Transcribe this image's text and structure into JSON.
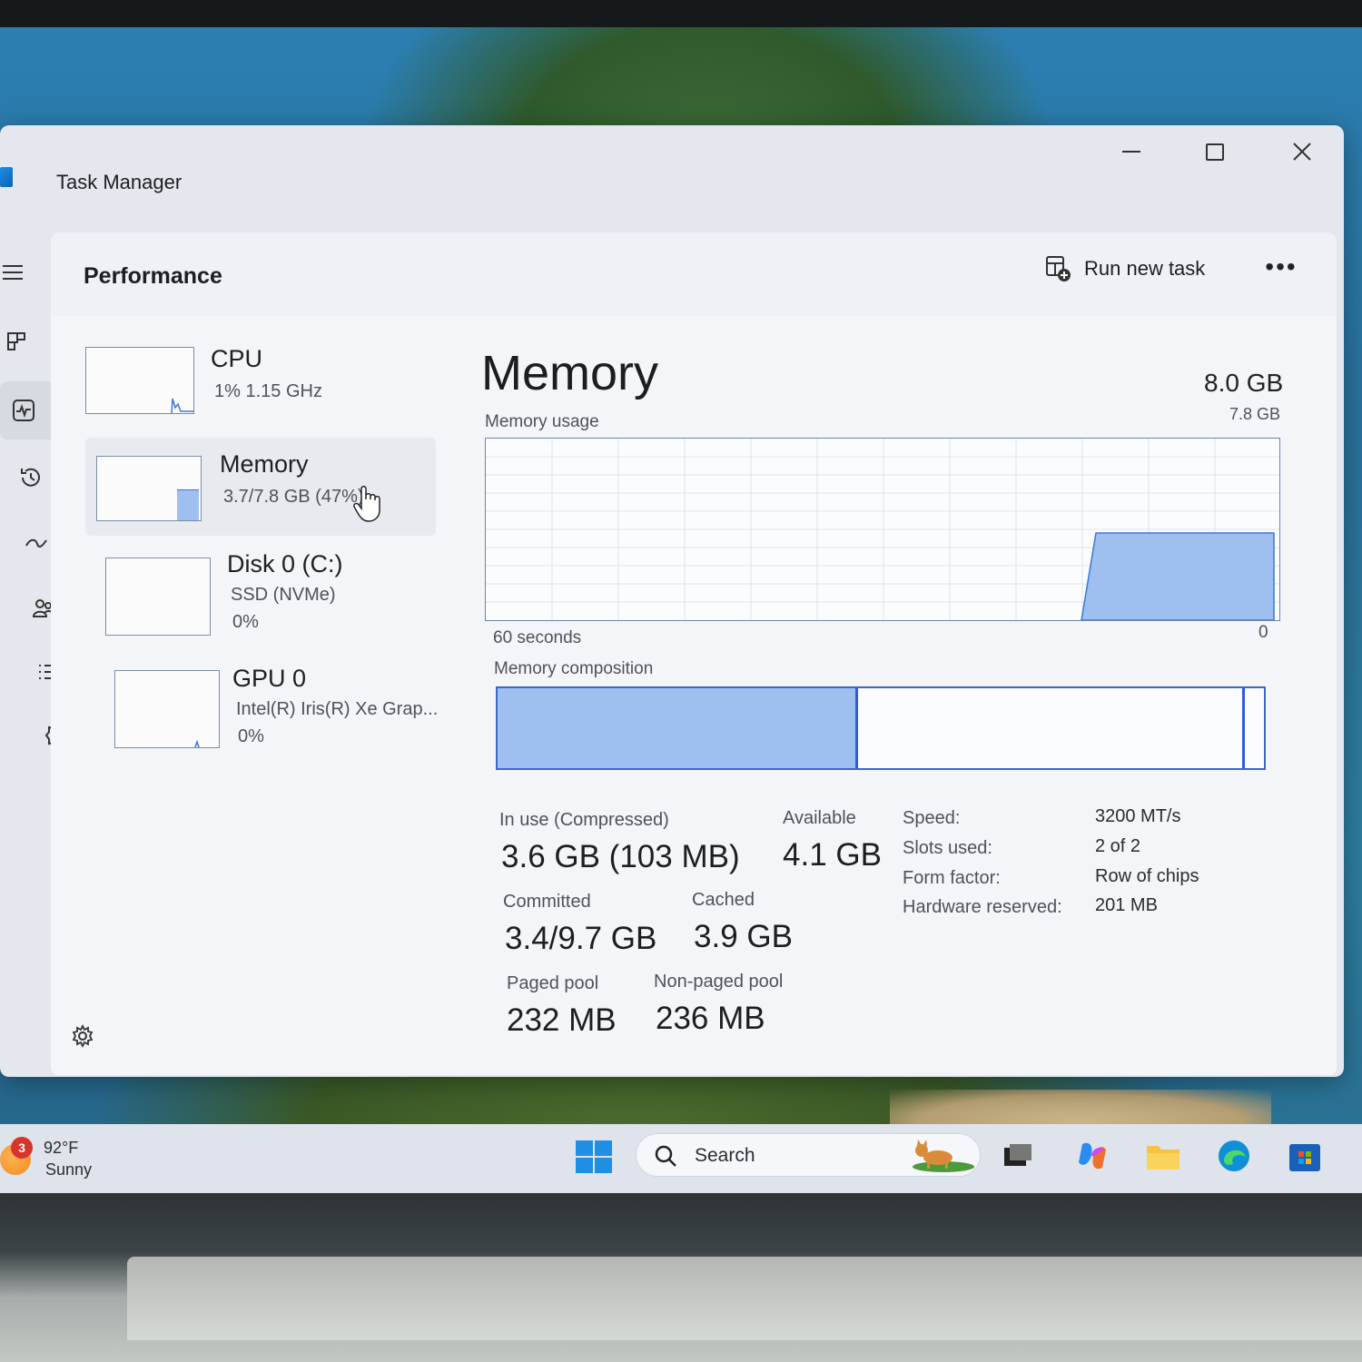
{
  "window": {
    "title": "Task Manager",
    "controls": [
      "minimize",
      "maximize",
      "close"
    ]
  },
  "nav": {
    "icons": [
      "menu-icon",
      "processes-icon",
      "performance-icon",
      "app-history-icon",
      "startup-apps-icon",
      "users-icon",
      "details-icon",
      "services-icon",
      "settings-icon"
    ],
    "active": "performance-icon"
  },
  "header": {
    "title": "Performance",
    "run_new_task": "Run new task",
    "more": "•••"
  },
  "devices": [
    {
      "name": "CPU",
      "line1": "1%  1.15 GHz",
      "line2": ""
    },
    {
      "name": "Memory",
      "line1": "3.7/7.8 GB (47%)",
      "line2": "",
      "selected": true
    },
    {
      "name": "Disk 0 (C:)",
      "line1": "SSD (NVMe)",
      "line2": "0%"
    },
    {
      "name": "GPU 0",
      "line1": "Intel(R) Iris(R) Xe Grap...",
      "line2": "0%"
    }
  ],
  "memory": {
    "title": "Memory",
    "total": "8.0 GB",
    "usage_label": "Memory usage",
    "usage_max": "7.8 GB",
    "time_span": "60 seconds",
    "axis_zero": "0",
    "composition_label": "Memory composition",
    "in_use_fraction": 0.47,
    "stats": {
      "in_use_label": "In use (Compressed)",
      "in_use_value": "3.6 GB (103 MB)",
      "available_label": "Available",
      "available_value": "4.1 GB",
      "committed_label": "Committed",
      "committed_value": "3.4/9.7 GB",
      "cached_label": "Cached",
      "cached_value": "3.9 GB",
      "paged_label": "Paged pool",
      "paged_value": "232 MB",
      "nonpaged_label": "Non-paged pool",
      "nonpaged_value": "236 MB"
    },
    "details": [
      {
        "k": "Speed:",
        "v": "3200 MT/s"
      },
      {
        "k": "Slots used:",
        "v": "2 of 2"
      },
      {
        "k": "Form factor:",
        "v": "Row of chips"
      },
      {
        "k": "Hardware reserved:",
        "v": "201 MB"
      }
    ]
  },
  "taskbar": {
    "weather_badge": "3",
    "temperature": "92°F",
    "condition": "Sunny",
    "search_placeholder": "Search",
    "apps": [
      "start-icon",
      "task-view-icon",
      "copilot-icon",
      "file-explorer-icon",
      "edge-icon",
      "store-icon"
    ]
  },
  "colors": {
    "accent": "#2f5fcf",
    "fill": "#9fbff0",
    "window_bg": "#e4e8ee"
  }
}
